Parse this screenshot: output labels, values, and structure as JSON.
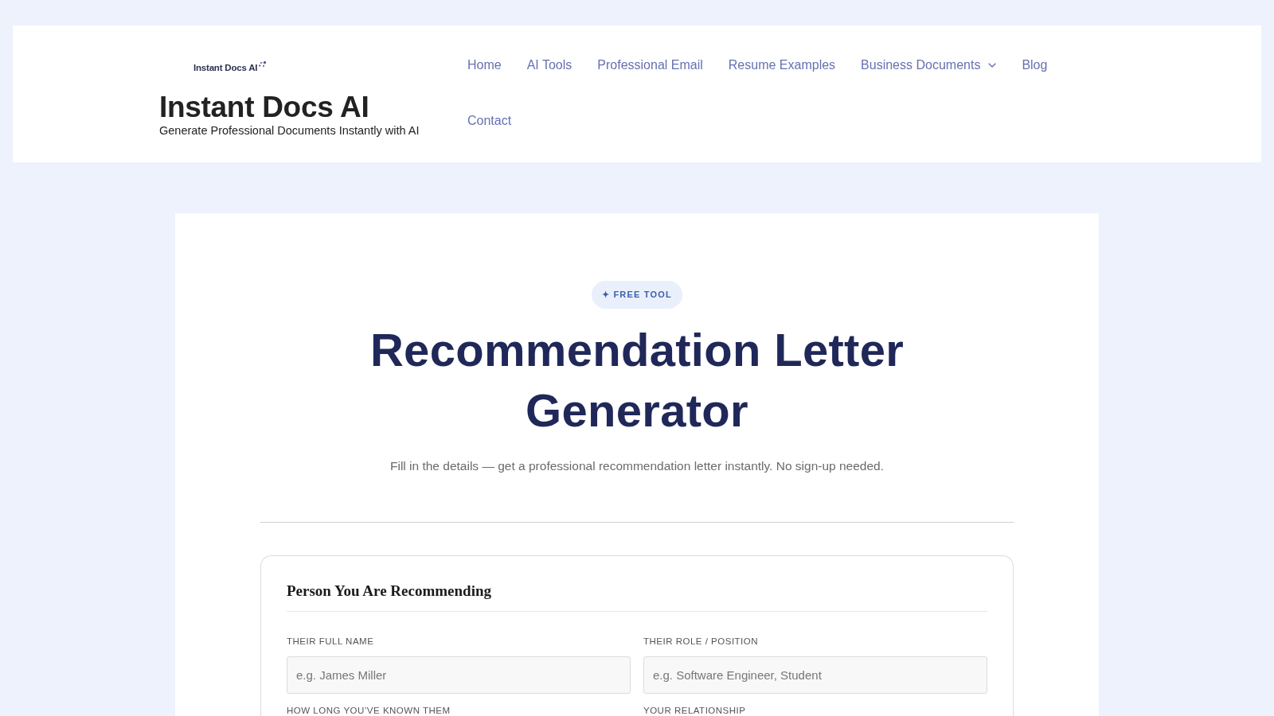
{
  "header": {
    "logo_text": "Instant Docs AI",
    "site_title": "Instant Docs AI",
    "tagline": "Generate Professional Documents Instantly with AI",
    "nav": [
      {
        "label": "Home",
        "has_dropdown": false
      },
      {
        "label": "AI Tools",
        "has_dropdown": false
      },
      {
        "label": "Professional Email",
        "has_dropdown": false
      },
      {
        "label": "Resume Examples",
        "has_dropdown": false
      },
      {
        "label": "Business Documents",
        "has_dropdown": true
      },
      {
        "label": "Blog",
        "has_dropdown": false
      },
      {
        "label": "Contact",
        "has_dropdown": false
      }
    ]
  },
  "hero": {
    "badge": "✦ FREE TOOL",
    "title": "Recommendation Letter Generator",
    "subtitle": "Fill in the details — get a professional recommendation letter instantly. No sign-up needed."
  },
  "form": {
    "section_title": "Person You Are Recommending",
    "fields": [
      {
        "label": "THEIR FULL NAME",
        "placeholder": "e.g. James Miller"
      },
      {
        "label": "THEIR ROLE / POSITION",
        "placeholder": "e.g. Software Engineer, Student"
      },
      {
        "label": "HOW LONG YOU’VE KNOWN THEM"
      },
      {
        "label": "YOUR RELATIONSHIP"
      }
    ]
  }
}
